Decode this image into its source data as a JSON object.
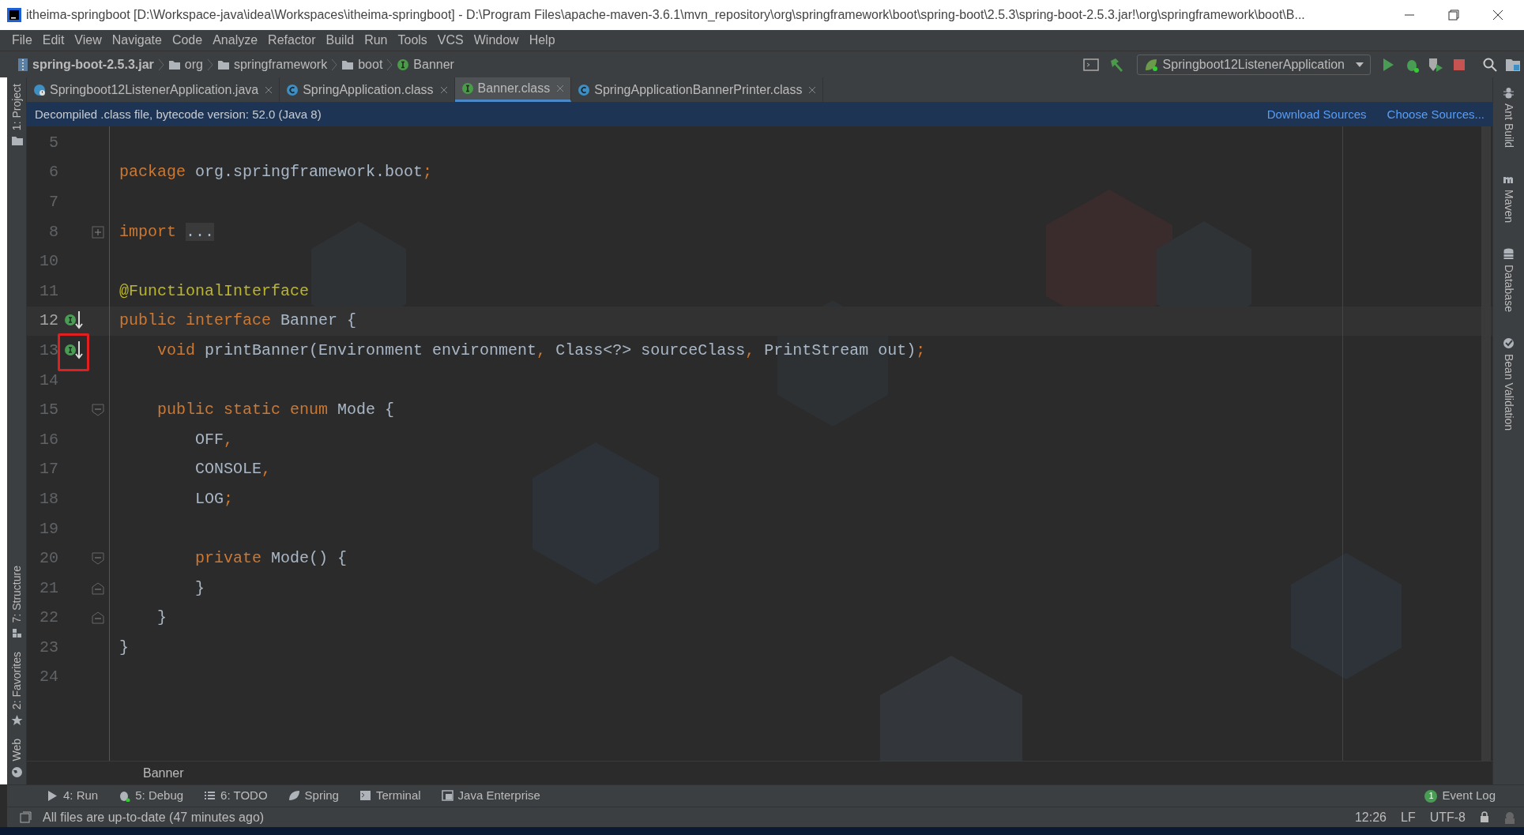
{
  "window": {
    "title": "itheima-springboot [D:\\Workspace-java\\idea\\Workspaces\\itheima-springboot] - D:\\Program Files\\apache-maven-3.6.1\\mvn_repository\\org\\springframework\\boot\\spring-boot\\2.5.3\\spring-boot-2.5.3.jar!\\org\\springframework\\boot\\B..."
  },
  "menu": [
    "File",
    "Edit",
    "View",
    "Navigate",
    "Code",
    "Analyze",
    "Refactor",
    "Build",
    "Run",
    "Tools",
    "VCS",
    "Window",
    "Help"
  ],
  "breadcrumb": [
    {
      "label": "spring-boot-2.5.3.jar",
      "kind": "jar"
    },
    {
      "label": "org",
      "kind": "folder"
    },
    {
      "label": "springframework",
      "kind": "folder"
    },
    {
      "label": "boot",
      "kind": "folder"
    },
    {
      "label": "Banner",
      "kind": "interface"
    }
  ],
  "run_config": "Springboot12ListenerApplication",
  "tabs": [
    {
      "label": "Springboot12ListenerApplication.java",
      "kind": "app",
      "selected": false
    },
    {
      "label": "SpringApplication.class",
      "kind": "class",
      "selected": false
    },
    {
      "label": "Banner.class",
      "kind": "interface",
      "selected": true
    },
    {
      "label": "SpringApplicationBannerPrinter.class",
      "kind": "class",
      "selected": false
    }
  ],
  "notice": {
    "text": "Decompiled .class file, bytecode version: 52.0 (Java 8)",
    "links": [
      "Download Sources",
      "Choose Sources..."
    ]
  },
  "left_tools": [
    {
      "label": "1: Project",
      "kind": "folder"
    },
    {
      "label": "7: Structure",
      "kind": "structure"
    },
    {
      "label": "2: Favorites",
      "kind": "star"
    },
    {
      "label": "Web",
      "kind": "globe"
    }
  ],
  "right_tools": [
    {
      "label": "Ant Build",
      "kind": "ant"
    },
    {
      "label": "Maven",
      "kind": "maven"
    },
    {
      "label": "Database",
      "kind": "database"
    },
    {
      "label": "Bean Validation",
      "kind": "bean"
    }
  ],
  "code": [
    {
      "number": "5"
    },
    {
      "number": "6",
      "tokens": [
        {
          "text": "package ",
          "kind": "keyword"
        },
        {
          "text": "org.springframework.boot",
          "kind": "plain"
        },
        {
          "text": ";",
          "kind": "keyword"
        }
      ]
    },
    {
      "number": "7"
    },
    {
      "number": "8",
      "collapsed_fold": true,
      "tokens": [
        {
          "text": "import ",
          "kind": "keyword"
        },
        {
          "text": "...",
          "kind": "folded"
        }
      ]
    },
    {
      "number": "10"
    },
    {
      "number": "11",
      "tokens": [
        {
          "text": "@FunctionalInterface",
          "kind": "annotation"
        }
      ]
    },
    {
      "number": "12",
      "current": true,
      "implemented_marker": true,
      "tokens": [
        {
          "text": "public interface ",
          "kind": "keyword"
        },
        {
          "text": "Banner {",
          "kind": "plain"
        }
      ]
    },
    {
      "number": "13",
      "marked": true,
      "implemented_marker": true,
      "tokens": [
        {
          "text": "    void ",
          "kind": "keyword"
        },
        {
          "text": "printBanner",
          "kind": "method"
        },
        {
          "text": "(Environment environment",
          "kind": "plain"
        },
        {
          "text": ", ",
          "kind": "keyword"
        },
        {
          "text": "Class<?> sourceClass",
          "kind": "plain"
        },
        {
          "text": ", ",
          "kind": "keyword"
        },
        {
          "text": "PrintStream out)",
          "kind": "plain"
        },
        {
          "text": ";",
          "kind": "keyword"
        }
      ]
    },
    {
      "number": "14"
    },
    {
      "number": "15",
      "fold_start": true,
      "tokens": [
        {
          "text": "    public static enum ",
          "kind": "keyword"
        },
        {
          "text": "Mode {",
          "kind": "plain"
        }
      ]
    },
    {
      "number": "16",
      "tokens": [
        {
          "text": "        OFF",
          "kind": "plain"
        },
        {
          "text": ",",
          "kind": "keyword"
        }
      ]
    },
    {
      "number": "17",
      "tokens": [
        {
          "text": "        CONSOLE",
          "kind": "plain"
        },
        {
          "text": ",",
          "kind": "keyword"
        }
      ]
    },
    {
      "number": "18",
      "tokens": [
        {
          "text": "        LOG",
          "kind": "plain"
        },
        {
          "text": ";",
          "kind": "keyword"
        }
      ]
    },
    {
      "number": "19"
    },
    {
      "number": "20",
      "fold_start": true,
      "tokens": [
        {
          "text": "        private ",
          "kind": "keyword"
        },
        {
          "text": "Mode() {",
          "kind": "plain"
        }
      ]
    },
    {
      "number": "21",
      "fold_end": true,
      "tokens": [
        {
          "text": "        }",
          "kind": "plain"
        }
      ]
    },
    {
      "number": "22",
      "fold_end": true,
      "tokens": [
        {
          "text": "    }",
          "kind": "plain"
        }
      ]
    },
    {
      "number": "23",
      "tokens": [
        {
          "text": "}",
          "kind": "plain"
        }
      ]
    },
    {
      "number": "24"
    }
  ],
  "editor_breadcrumb": "Banner",
  "tool_windows": [
    {
      "label": "4: Run",
      "kind": "run"
    },
    {
      "label": "5: Debug",
      "kind": "debug"
    },
    {
      "label": "6: TODO",
      "kind": "todo"
    },
    {
      "label": "Spring",
      "kind": "spring"
    },
    {
      "label": "Terminal",
      "kind": "terminal"
    },
    {
      "label": "Java Enterprise",
      "kind": "enterprise"
    }
  ],
  "event_log": {
    "label": "Event Log",
    "count": "1"
  },
  "status_bar": {
    "message": "All files are up-to-date (47 minutes ago)",
    "position": "12:26",
    "line_separator": "LF",
    "encoding": "UTF-8"
  }
}
